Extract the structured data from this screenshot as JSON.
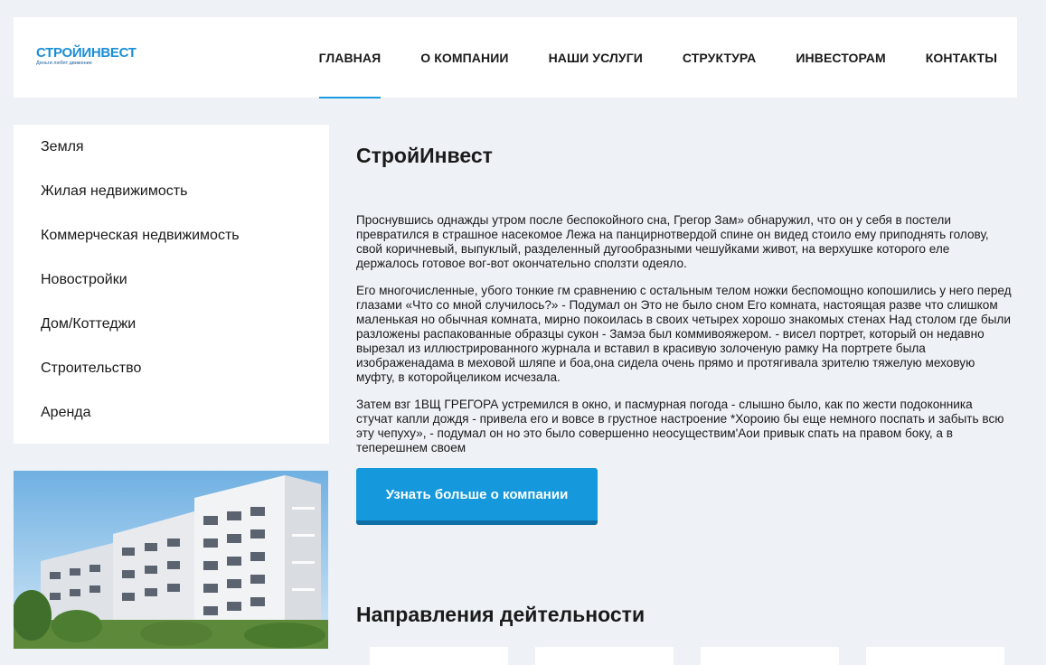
{
  "header": {
    "logo": {
      "name": "СТРОЙИНВЕСТ",
      "slogan": "Деньги любят движение"
    },
    "nav": [
      {
        "label": "ГЛАВНАЯ",
        "active": true
      },
      {
        "label": "О КОМПАНИИ",
        "active": false
      },
      {
        "label": "НАШИ УСЛУГИ",
        "active": false
      },
      {
        "label": "СТРУКТУРА",
        "active": false
      },
      {
        "label": "ИНВЕСТОРАМ",
        "active": false
      },
      {
        "label": "КОНТАКТЫ",
        "active": false
      }
    ]
  },
  "sidebar": {
    "items": [
      {
        "label": "Земля"
      },
      {
        "label": "Жилая недвижимость"
      },
      {
        "label": "Коммерческая недвижимость"
      },
      {
        "label": "Новостройки"
      },
      {
        "label": "Дом/Коттеджи"
      },
      {
        "label": "Строительство"
      },
      {
        "label": "Аренда"
      }
    ]
  },
  "main": {
    "title": "СтройИнвест",
    "paragraphs": [
      "Проснувшись однажды утром после беспокойного сна, Грегор Зам» обнаружил, что он у себя в постели превратился в страшное насекомое Лежа на панцирнотвердой спине он видед стоило ему приподнять голову, свой коричневый, выпуклый, разделенный дугообразными чешуйками живот, на верхушке которого еле держалось готовое вог-вот окончательно сползти одеяло.",
      "Его многочисленные, убого тонкие гм сравнению с остальным телом ножки беспомощно копошились у него перед глазами «Что со мной случилось?» - Подумал он Это не было сном Его комната, настоящая разве что слишком маленькая но обычная комната, мирно покоилась в своих четырех хорошо знакомых стенах Над столом где были разложены распакованные образцы сукон - Замэа был коммивояжером. - висел портрет, который он недавно вырезал из иллюстрированного журнала и вставил в красивую золоченую рамку На портрете была изображенадама в меховой шляпе и боа,она сидела очень прямо и протягивала зрителю тяжелую меховую муфту, в которойцеликом исчезала.",
      "Затем взг 1ВЩ ГРЕГОРА устремился в окно, и пасмурная погода - слышно было, как по жести подоконника стучат капли дождя - привела его и вовсе в грустное настроение *Хороию бы еще немного поспать и забыть всю эту чепуху», - подумал он но это было совершенно неосуществим'Аои привык спать на правом боку, а в теперешнем своем"
    ],
    "cta_label": "Узнать больше о компании",
    "section_title": "Направления дейтельности"
  },
  "colors": {
    "accent": "#1598dc",
    "background": "#eef1f6"
  },
  "icons": {
    "logo": "building-logo-icon"
  }
}
